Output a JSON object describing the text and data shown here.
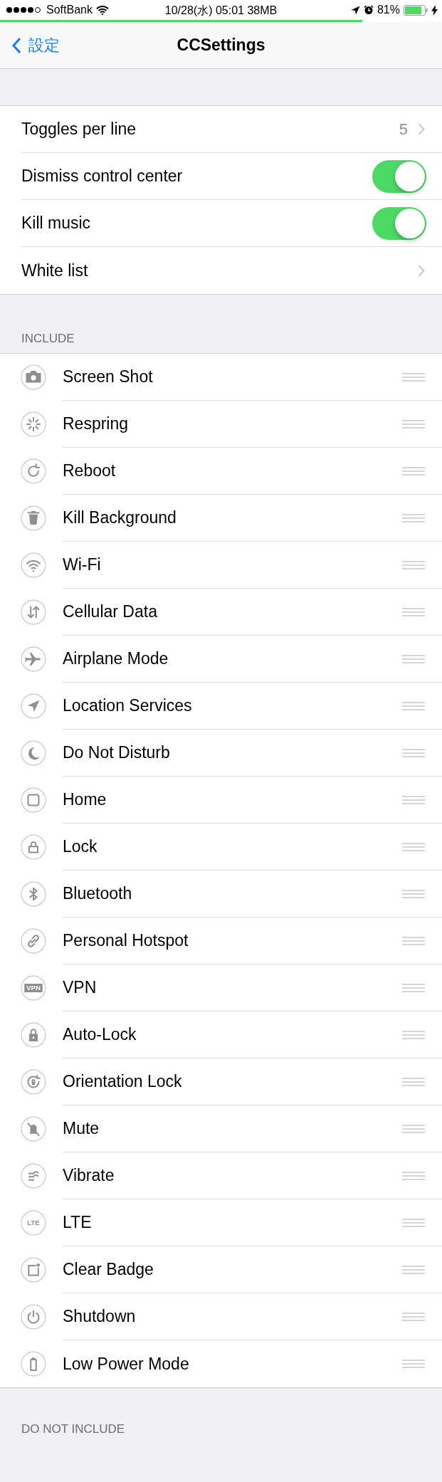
{
  "status_bar": {
    "carrier": "SoftBank",
    "center": "10/28(水) 05:01 38MB",
    "battery": "81%"
  },
  "progress": {
    "level": 0.82
  },
  "nav": {
    "back": "設定",
    "title": "CCSettings"
  },
  "settings": [
    {
      "kind": "value",
      "label": "Toggles per line",
      "value": "5"
    },
    {
      "kind": "toggle",
      "label": "Dismiss control center",
      "on": true
    },
    {
      "kind": "toggle",
      "label": "Kill music",
      "on": true
    },
    {
      "kind": "link",
      "label": "White list"
    }
  ],
  "include": {
    "header": "INCLUDE",
    "items": [
      {
        "label": "Screen Shot"
      },
      {
        "label": "Respring"
      },
      {
        "label": "Reboot"
      },
      {
        "label": "Kill Background"
      },
      {
        "label": "Wi-Fi"
      },
      {
        "label": "Cellular Data"
      },
      {
        "label": "Airplane Mode"
      },
      {
        "label": "Location Services"
      },
      {
        "label": "Do Not Disturb"
      },
      {
        "label": "Home"
      },
      {
        "label": "Lock"
      },
      {
        "label": "Bluetooth"
      },
      {
        "label": "Personal Hotspot"
      },
      {
        "label": "VPN",
        "icon_text": "VPN"
      },
      {
        "label": "Auto-Lock"
      },
      {
        "label": "Orientation Lock"
      },
      {
        "label": "Mute"
      },
      {
        "label": "Vibrate"
      },
      {
        "label": "LTE",
        "icon_text": "LTE"
      },
      {
        "label": "Clear Badge"
      },
      {
        "label": "Shutdown"
      },
      {
        "label": "Low Power Mode"
      }
    ]
  },
  "exclude": {
    "header": "DO NOT INCLUDE"
  }
}
